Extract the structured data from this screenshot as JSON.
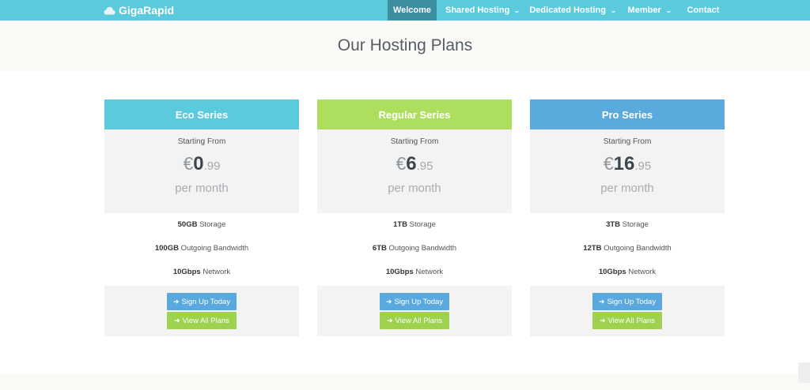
{
  "brand": {
    "name": "GigaRapid",
    "icon": "cloud-icon"
  },
  "nav": {
    "items": [
      {
        "label": "Welcome",
        "active": true,
        "has_dropdown": false
      },
      {
        "label": "Shared Hosting",
        "active": false,
        "has_dropdown": true
      },
      {
        "label": "Dedicated Hosting",
        "active": false,
        "has_dropdown": true
      },
      {
        "label": "Member",
        "active": false,
        "has_dropdown": true
      },
      {
        "label": "Contact",
        "active": false,
        "has_dropdown": false
      }
    ]
  },
  "page": {
    "title": "Our Hosting Plans"
  },
  "plans": [
    {
      "name": "Eco Series",
      "color": "#5bcadd",
      "starting_label": "Starting From",
      "currency": "€",
      "price_whole": "0",
      "price_decimal": ".99",
      "period": "per month",
      "features": [
        {
          "value": "50GB",
          "label": " Storage"
        },
        {
          "value": "100GB",
          "label": " Outgoing Bandwidth"
        },
        {
          "value": "10Gbps",
          "label": " Network"
        }
      ],
      "signup_label": "Sign Up Today",
      "view_label": "View All Plans"
    },
    {
      "name": "Regular Series",
      "color": "#aede5d",
      "starting_label": "Starting From",
      "currency": "€",
      "price_whole": "6",
      "price_decimal": ".95",
      "period": "per month",
      "features": [
        {
          "value": "1TB",
          "label": " Storage"
        },
        {
          "value": "6TB",
          "label": " Outgoing Bandwidth"
        },
        {
          "value": "10Gbps",
          "label": " Network"
        }
      ],
      "signup_label": "Sign Up Today",
      "view_label": "View All Plans"
    },
    {
      "name": "Pro Series",
      "color": "#5aaade",
      "starting_label": "Starting From",
      "currency": "€",
      "price_whole": "16",
      "price_decimal": ".95",
      "period": "per month",
      "features": [
        {
          "value": "3TB",
          "label": " Storage"
        },
        {
          "value": "12TB",
          "label": " Outgoing Bandwidth"
        },
        {
          "value": "10Gbps",
          "label": " Network"
        }
      ],
      "signup_label": "Sign Up Today",
      "view_label": "View All Plans"
    }
  ],
  "colors": {
    "navbar": "#5bcadd",
    "nav_active": "#3c8fa3",
    "signup_button": "#5aa9de",
    "view_button": "#9dd14e"
  }
}
